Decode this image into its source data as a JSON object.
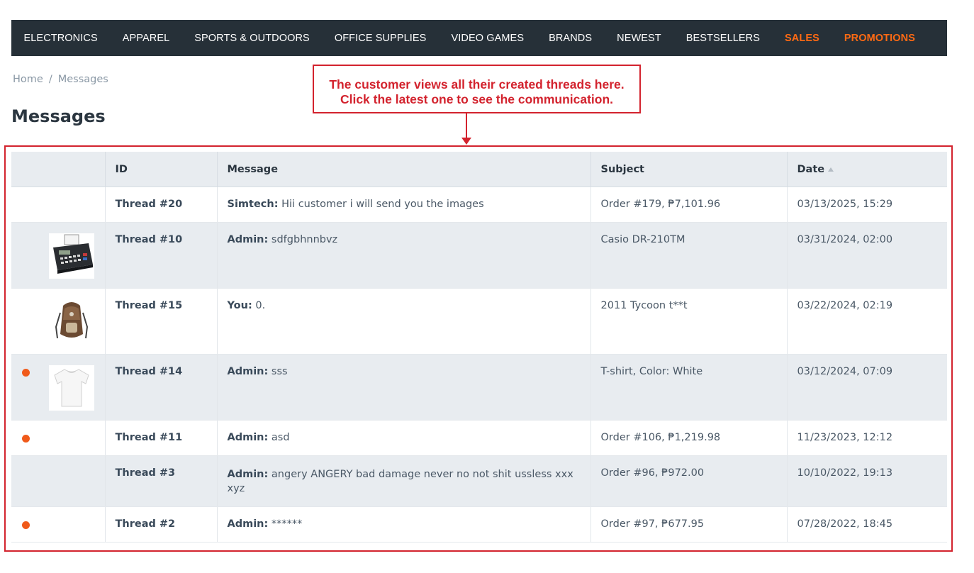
{
  "nav": {
    "items": [
      {
        "label": "ELECTRONICS",
        "highlight": false
      },
      {
        "label": "APPAREL",
        "highlight": false
      },
      {
        "label": "SPORTS & OUTDOORS",
        "highlight": false
      },
      {
        "label": "OFFICE SUPPLIES",
        "highlight": false
      },
      {
        "label": "VIDEO GAMES",
        "highlight": false
      },
      {
        "label": "BRANDS",
        "highlight": false
      },
      {
        "label": "NEWEST",
        "highlight": false
      },
      {
        "label": "BESTSELLERS",
        "highlight": false
      },
      {
        "label": "SALES",
        "highlight": true
      },
      {
        "label": "PROMOTIONS",
        "highlight": true
      }
    ]
  },
  "breadcrumb": {
    "home": "Home",
    "separator": "/",
    "current": "Messages"
  },
  "page": {
    "title": "Messages"
  },
  "callout": {
    "line1": "The customer views all their created threads here.",
    "line2": "Click the latest one to see the communication."
  },
  "table": {
    "headers": {
      "id": "ID",
      "message": "Message",
      "subject": "Subject",
      "date": "Date"
    },
    "rows": [
      {
        "unread": false,
        "thumb": "none",
        "id": "Thread #20",
        "author": "Simtech:",
        "text": "Hii customer i will send you the images",
        "subject": "Order #179, ₱7,101.96",
        "date": "03/13/2025, 15:29"
      },
      {
        "unread": false,
        "thumb": "calculator",
        "id": "Thread #10",
        "author": "Admin:",
        "text": "sdfgbhnnbvz",
        "subject": "Casio DR-210TM",
        "date": "03/31/2024, 02:00"
      },
      {
        "unread": false,
        "thumb": "backpack",
        "id": "Thread #15",
        "author": "You:",
        "text": "0.",
        "subject": "2011 Tycoon t**t",
        "date": "03/22/2024, 02:19"
      },
      {
        "unread": true,
        "thumb": "tshirt",
        "id": "Thread #14",
        "author": "Admin:",
        "text": "sss",
        "subject": "T-shirt, Color: White",
        "date": "03/12/2024, 07:09"
      },
      {
        "unread": true,
        "thumb": "none",
        "id": "Thread #11",
        "author": "Admin:",
        "text": "asd",
        "subject": "Order #106, ₱1,219.98",
        "date": "11/23/2023, 12:12"
      },
      {
        "unread": false,
        "thumb": "none",
        "id": "Thread #3",
        "author": "Admin:",
        "text": "angery ANGERY bad damage never no not shit ussless xxx xyz",
        "subject": "Order #96, ₱972.00",
        "date": "10/10/2022, 19:13"
      },
      {
        "unread": true,
        "thumb": "none",
        "id": "Thread #2",
        "author": "Admin:",
        "text": "******",
        "subject": "Order #97, ₱677.95",
        "date": "07/28/2022, 18:45"
      }
    ]
  },
  "colors": {
    "nav_bg": "#263038",
    "accent": "#ff6a13",
    "callout": "#d3232e",
    "unread_dot": "#f05a1a"
  }
}
